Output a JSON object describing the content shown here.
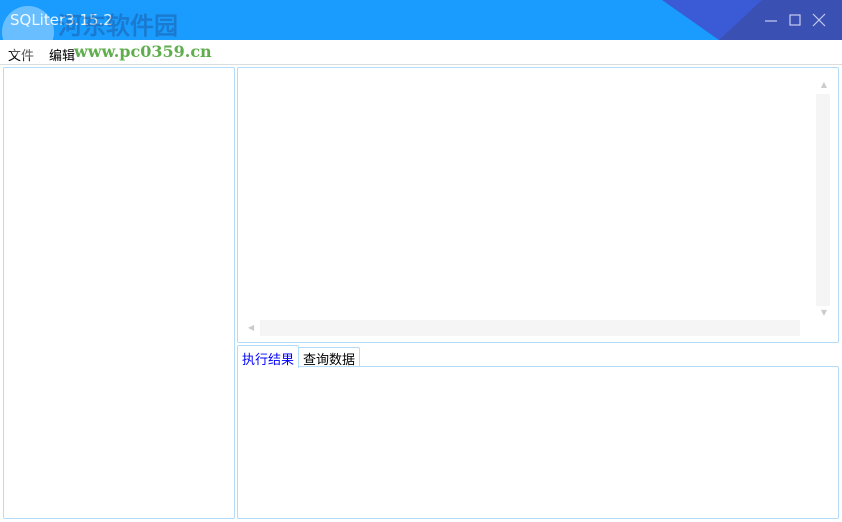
{
  "window": {
    "title": "SQLiter3.15.2"
  },
  "watermark": {
    "name": "河东软件园",
    "url": "www.pc0359.cn"
  },
  "menu": [
    "文件",
    "编辑"
  ],
  "tabs": [
    {
      "label": "执行结果",
      "active": true
    },
    {
      "label": "查询数据",
      "active": false
    }
  ],
  "colors": {
    "titlebar": "#1a9cff",
    "accent": "#3b4fb0",
    "border": "#b3dcfa",
    "active_tab_text": "#0000ff"
  }
}
